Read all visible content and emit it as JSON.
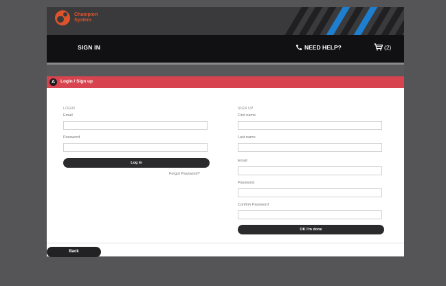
{
  "brand": {
    "name_line1": "Champion",
    "name_line2": "System"
  },
  "nav": {
    "signin_label": "SIGN IN",
    "help_label": "NEED HELP?",
    "cart_count": "(2)"
  },
  "header": {
    "step": "A",
    "title": "Login / Sign up"
  },
  "login": {
    "section_label": "LOGIN",
    "email_label": "Email",
    "password_label": "Password",
    "email_value": "",
    "password_value": "",
    "login_button": "Log in",
    "forgot_link": "Forgot Password?"
  },
  "signup": {
    "section_label": "SIGN UP",
    "first_name_label": "First name",
    "last_name_label": "Last name",
    "email_label": "Email",
    "password_label": "Password",
    "confirm_password_label": "Confirm Password",
    "submit_button": "OK I'm done"
  },
  "footer": {
    "back_button": "Back"
  },
  "colors": {
    "accent_red": "#d7434e",
    "brand_orange": "#e0532a",
    "stripe_blue": "#1e7fd1",
    "nav_bg": "#111113"
  },
  "icons": [
    "logo-icon",
    "phone-icon",
    "cart-icon"
  ]
}
